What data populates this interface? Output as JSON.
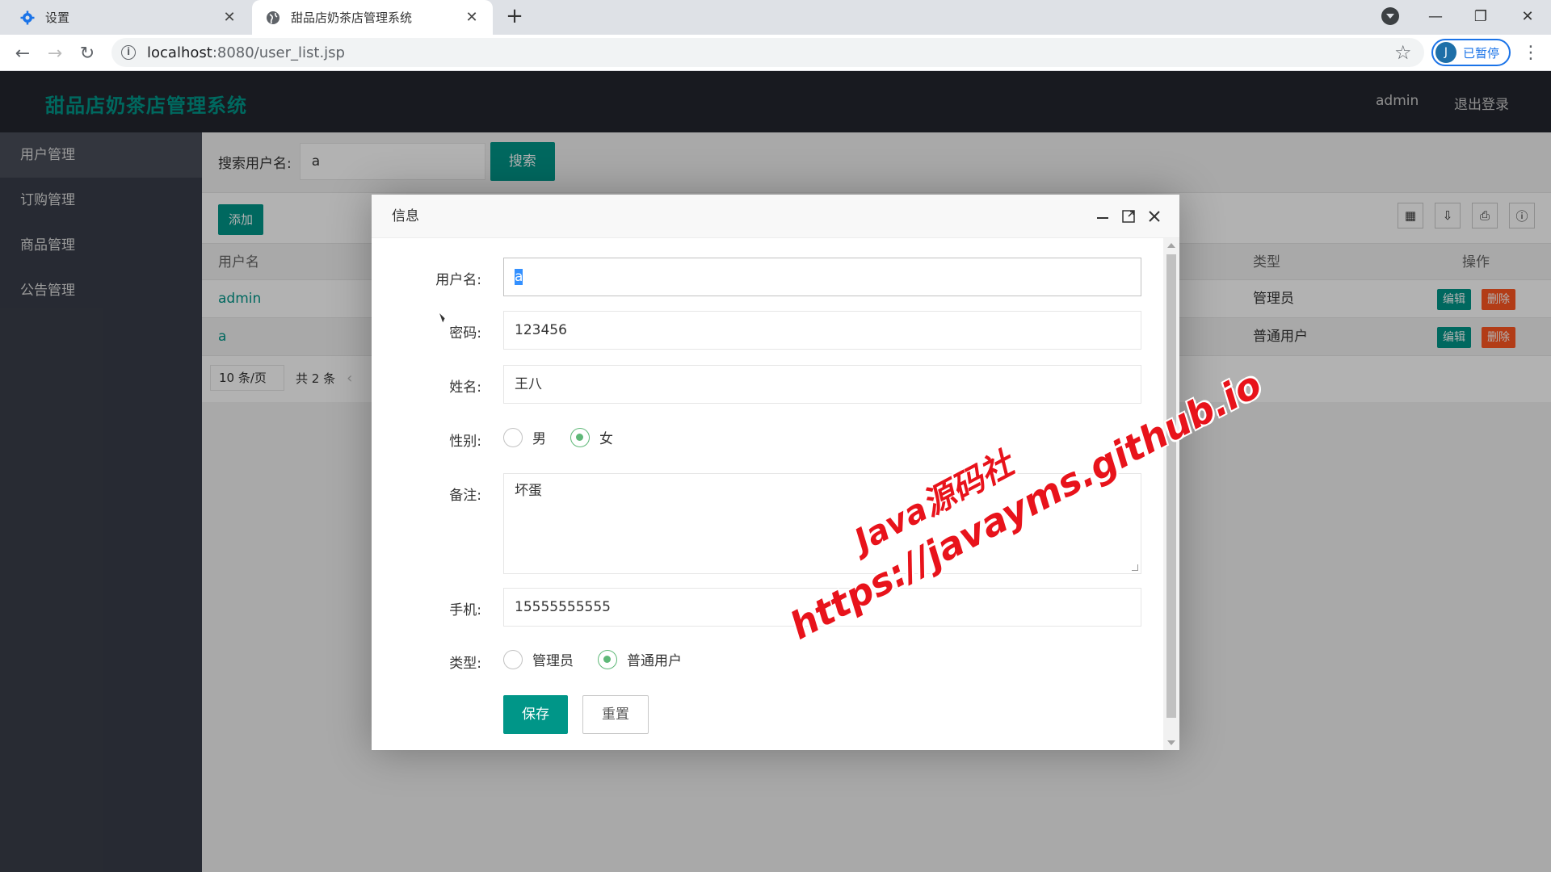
{
  "browser": {
    "tabs": [
      {
        "title": "设置",
        "icon": "gear-icon"
      },
      {
        "title": "甜品店奶茶店管理系统",
        "icon": "globe-icon"
      }
    ],
    "new_tab": "+",
    "url_host": "localhost",
    "url_path": ":8080/user_list.jsp",
    "profile_initial": "J",
    "profile_status": "已暂停"
  },
  "app": {
    "title": "甜品店奶茶店管理系统",
    "user": "admin",
    "logout": "退出登录",
    "accent_color": "#009688"
  },
  "sidebar": {
    "items": [
      {
        "label": "用户管理"
      },
      {
        "label": "订购管理"
      },
      {
        "label": "商品管理"
      },
      {
        "label": "公告管理"
      }
    ]
  },
  "search": {
    "label": "搜索用户名:",
    "value": "a",
    "button": "搜索"
  },
  "table": {
    "add_button": "添加",
    "headers": {
      "username": "用户名",
      "type": "类型",
      "ops": "操作"
    },
    "rows": [
      {
        "username": "admin",
        "type": "管理员"
      },
      {
        "username": "a",
        "type": "普通用户"
      }
    ],
    "edit_label": "编辑",
    "delete_label": "删除",
    "page_size": "10 条/页",
    "total": "共 2 条"
  },
  "dialog": {
    "title": "信息",
    "fields": {
      "username": {
        "label": "用户名:",
        "value": "a"
      },
      "password": {
        "label": "密码:",
        "value": "123456"
      },
      "name": {
        "label": "姓名:",
        "value": "王八"
      },
      "gender": {
        "label": "性别:",
        "options": [
          "男",
          "女"
        ],
        "selected": "女"
      },
      "note": {
        "label": "备注:",
        "value": "坏蛋"
      },
      "phone": {
        "label": "手机:",
        "value": "15555555555"
      },
      "type": {
        "label": "类型:",
        "options": [
          "管理员",
          "普通用户"
        ],
        "selected": "普通用户"
      }
    },
    "save": "保存",
    "reset": "重置"
  },
  "watermark": {
    "line1": "Java源码社",
    "line2": "https://javayms.github.io"
  }
}
